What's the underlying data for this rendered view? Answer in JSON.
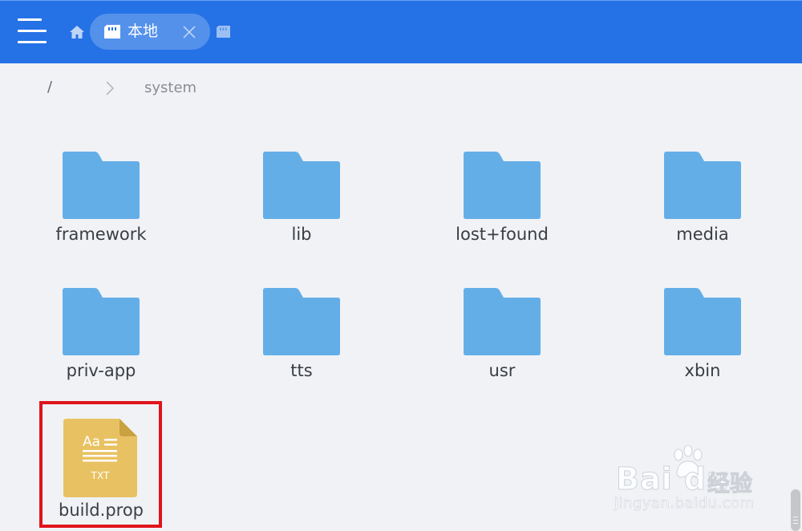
{
  "header": {
    "tab_label": "本地",
    "icons": [
      "menu-icon",
      "home-icon",
      "storage-icon",
      "close-icon",
      "storage-icon"
    ]
  },
  "breadcrumb": {
    "root": "/",
    "current": "system"
  },
  "items": [
    {
      "name": "framework",
      "type": "folder"
    },
    {
      "name": "lib",
      "type": "folder"
    },
    {
      "name": "lost+found",
      "type": "folder"
    },
    {
      "name": "media",
      "type": "folder"
    },
    {
      "name": "priv-app",
      "type": "folder"
    },
    {
      "name": "tts",
      "type": "folder"
    },
    {
      "name": "usr",
      "type": "folder"
    },
    {
      "name": "xbin",
      "type": "folder"
    },
    {
      "name": "build.prop",
      "type": "file",
      "icon_text": "Aa",
      "icon_caption": "TXT"
    }
  ],
  "watermark": {
    "brand": "Bai du",
    "brand_cn": "经验",
    "url": "jingyan.baidu.com"
  },
  "colors": {
    "header_bg": "#2572e6",
    "folder": "#64aee8",
    "file_icon": "#e8c262",
    "highlight": "#e0141c",
    "background": "#f0f2f6"
  }
}
